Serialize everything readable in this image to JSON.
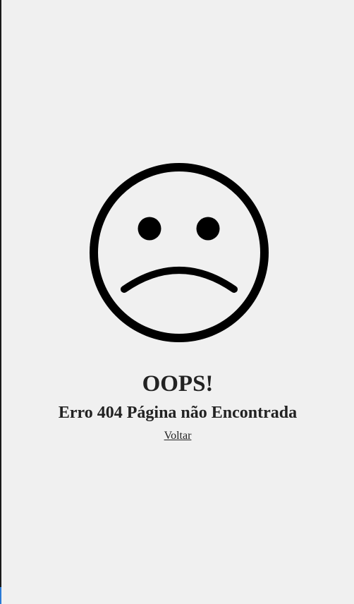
{
  "error_page": {
    "headline": "OOPS!",
    "message": "Erro 404 Página não Encontrada",
    "back_link_label": "Voltar",
    "face_icon": "sad-face-icon"
  },
  "colors": {
    "background": "#f0f0f0",
    "text": "#222222",
    "icon": "#000000",
    "left_edge": "#1a1a1a",
    "left_edge_accent": "#2a7ad6"
  }
}
